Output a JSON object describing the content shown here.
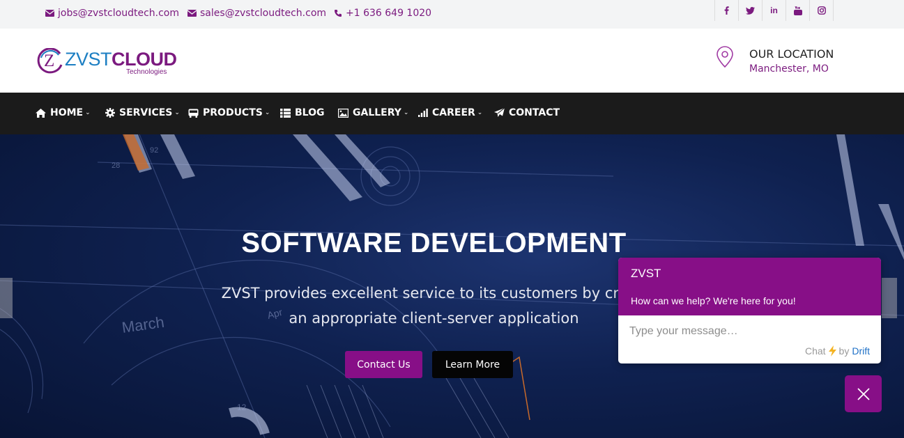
{
  "topbar": {
    "email_jobs": "jobs@zvstcloudtech.com",
    "email_sales": "sales@zvstcloudtech.com",
    "phone": "+1 636 649 1020",
    "social": [
      {
        "label": "f",
        "icon": "facebook-icon"
      },
      {
        "label": "t",
        "icon": "twitter-icon"
      },
      {
        "label": "in",
        "icon": "linkedin-icon"
      },
      {
        "label": "yt",
        "icon": "youtube-icon"
      },
      {
        "label": "ig",
        "icon": "instagram-icon"
      }
    ]
  },
  "header": {
    "logo": {
      "part1": "ZVST",
      "part2": "CLOUD",
      "sub": "Technologies",
      "mark": "Z"
    },
    "location_title": "OUR LOCATION",
    "location_city": "Manchester, MO"
  },
  "nav": {
    "items": [
      {
        "label": "HOME",
        "icon": "home-icon",
        "dropdown": true
      },
      {
        "label": "SERVICES",
        "icon": "gear-icon",
        "dropdown": true
      },
      {
        "label": "PRODUCTS",
        "icon": "bus-icon",
        "dropdown": true
      },
      {
        "label": "BLOG",
        "icon": "list-icon",
        "dropdown": false
      },
      {
        "label": "GALLERY",
        "icon": "image-icon",
        "dropdown": true
      },
      {
        "label": "CAREER",
        "icon": "signal-icon",
        "dropdown": true
      },
      {
        "label": "CONTACT",
        "icon": "paper-plane-icon",
        "dropdown": false
      }
    ]
  },
  "hero": {
    "title": "SOFTWARE DEVELOPMENT",
    "text_line1": "ZVST provides excellent service to its customers by creati",
    "text_line2": "an appropriate client-server application",
    "contact_button": "Contact Us",
    "learn_button": "Learn More",
    "bg_labels": {
      "month": "March",
      "apr": "Apr",
      "n28": "28",
      "n92": "92",
      "n12": "12"
    }
  },
  "chat": {
    "name": "ZVST",
    "help": "How can we help? We're here for you!",
    "placeholder": "Type your message…",
    "brand_chat": "Chat",
    "brand_by": "by",
    "brand_drift": "Drift"
  },
  "colors": {
    "brand_purple": "#870f87",
    "nav_bg": "#1b1b1b",
    "logo_blue": "#1d7fc3"
  }
}
